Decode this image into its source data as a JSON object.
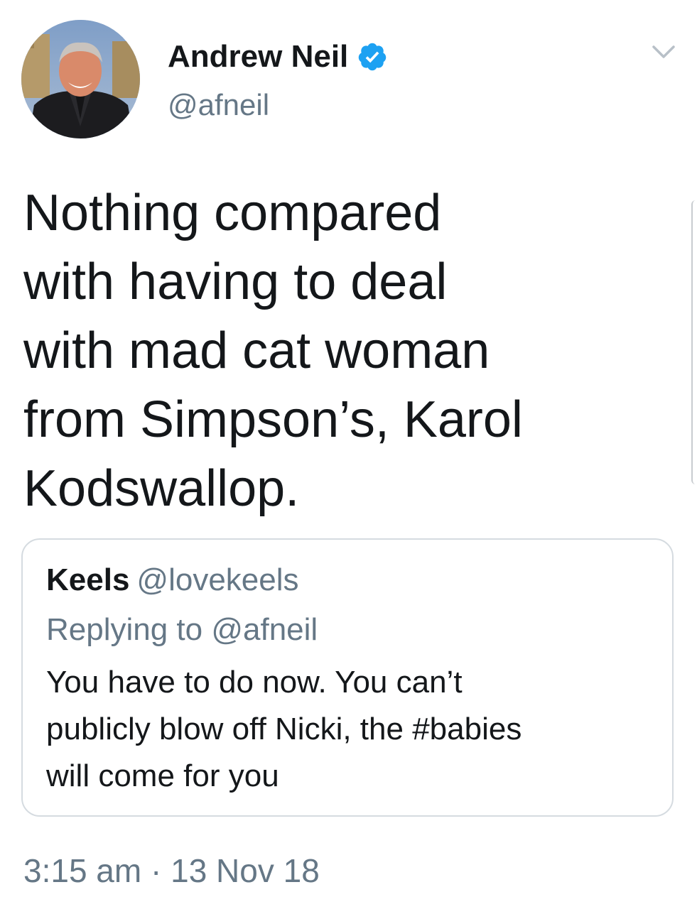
{
  "author": {
    "display_name": "Andrew Neil",
    "handle": "@afneil",
    "verified": true,
    "avatar_icon": "profile-photo"
  },
  "tweet": {
    "text": "Nothing compared\nwith having to deal\nwith mad cat woman\nfrom Simpson’s, Karol\nKodswallop.",
    "timestamp": "3:15 am",
    "separator": "·",
    "date": "13 Nov 18"
  },
  "quoted_tweet": {
    "display_name": "Keels",
    "handle": "@lovekeels",
    "replying_to": "Replying to @afneil",
    "text": "You have to do now. You can’t\npublicly blow off Nicki, the #babies\nwill come for you"
  },
  "icons": {
    "verified": "verified-badge-icon",
    "menu": "chevron-down-icon"
  },
  "colors": {
    "primary_text": "#14171a",
    "secondary_text": "#657786",
    "verified_blue": "#1da1f2",
    "card_border": "#d5dbe0"
  }
}
